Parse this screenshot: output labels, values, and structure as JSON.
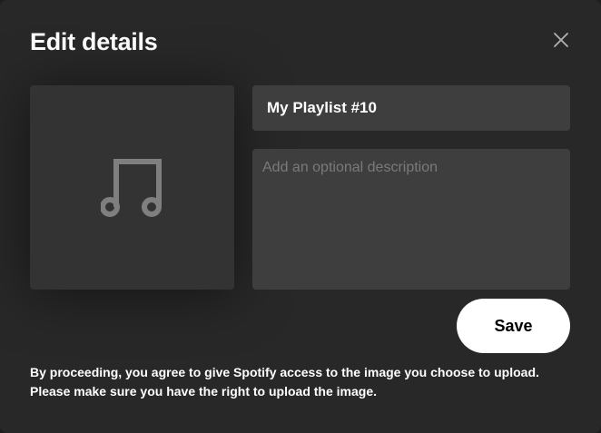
{
  "dialog": {
    "title": "Edit details",
    "close_icon": "close-icon"
  },
  "image": {
    "placeholder_icon": "music-note-icon"
  },
  "form": {
    "name_value": "My Playlist #10",
    "description_placeholder": "Add an optional description",
    "description_value": ""
  },
  "actions": {
    "save_label": "Save"
  },
  "disclaimer": {
    "line1": "By proceeding, you agree to give Spotify access to the image you choose to upload.",
    "line2": "Please make sure you have the right to upload the image."
  },
  "colors": {
    "dialog_bg": "#282828",
    "input_bg": "#3e3e3e",
    "image_bg": "#333333",
    "icon_gray": "#7f7f7f",
    "text": "#ffffff",
    "button_bg": "#ffffff"
  }
}
